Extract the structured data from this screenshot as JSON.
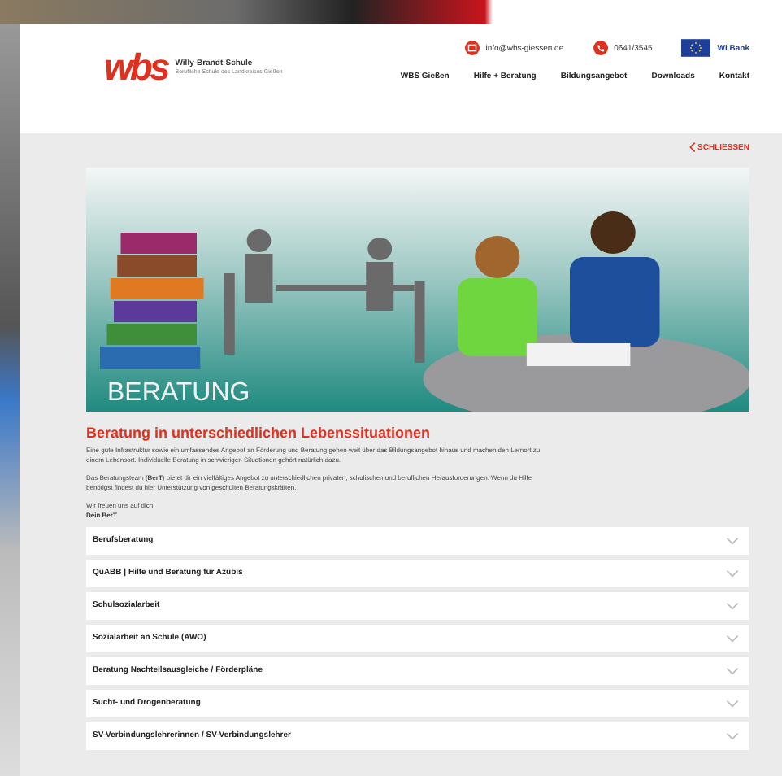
{
  "header": {
    "logo": "wbs",
    "school_name": "Willy-Brandt-Schule",
    "school_tagline": "Berufliche Schule des Landkreises Gießen",
    "email": "info@wbs-giessen.de",
    "phone": "0641/3545",
    "partner": "WI Bank"
  },
  "nav": [
    {
      "label": "WBS Gießen"
    },
    {
      "label": "Hilfe + Beratung"
    },
    {
      "label": "Bildungsangebot"
    },
    {
      "label": "Downloads"
    },
    {
      "label": "Kontakt"
    }
  ],
  "close_link": "SCHLIESSEN",
  "banner": {
    "caption": "BERATUNG"
  },
  "heading": "Beratung in unterschiedlichen Lebenssituationen",
  "paragraphs": [
    "Eine gute Infrastruktur sowie ein umfassendes Angebot an Förderung und Beratung gehen weit über das Bildungsangebot hinaus und machen den Lernort zu einem Lebensort. Individuelle Beratung in schwierigen Situationen gehört natürlich dazu.",
    "Das Beratungsteam (**BerT**) bietet dir ein vielfältiges Angebot zu unterschiedlichen privaten, schulischen und beruflichen Herausforderungen. Wenn du Hilfe benötigst findest du hier Unterstützung von geschulten Beratungskräften.",
    "Wir freuen uns auf dich."
  ],
  "signature": "Dein BerT",
  "accordion": [
    {
      "title": "Berufsberatung",
      "expanded": false
    },
    {
      "title": "QuABB | Hilfe und Beratung für Azubis",
      "expanded": false
    },
    {
      "title": "Schulsozialarbeit",
      "expanded": false
    },
    {
      "title": "Sozialarbeit an Schule (AWO)",
      "expanded": false
    },
    {
      "title": "Beratung Nachteilsausgleiche / Förderpläne",
      "expanded": false
    },
    {
      "title": "Sucht- und Drogenberatung",
      "expanded": false
    },
    {
      "title": "SV-Verbindungslehrerinnen / SV-Verbindungslehrer",
      "expanded": false
    }
  ]
}
